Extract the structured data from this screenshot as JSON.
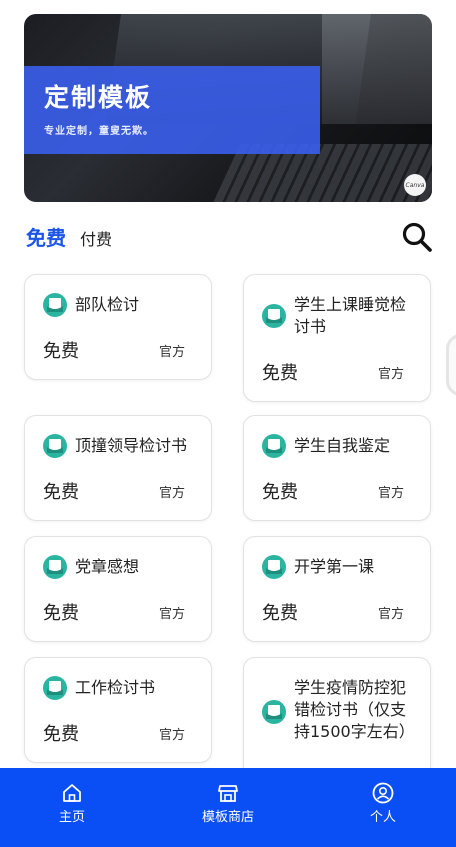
{
  "banner": {
    "title": "定制模板",
    "subtitle": "专业定制，童叟无欺。",
    "badge": "Canva"
  },
  "tabs": {
    "free": "免费",
    "paid": "付费"
  },
  "cards": [
    {
      "name": "部队检讨",
      "price": "免费",
      "tag": "官方"
    },
    {
      "name": "学生上课睡觉检讨书",
      "price": "免费",
      "tag": "官方"
    },
    {
      "name": "顶撞领导检讨书",
      "price": "免费",
      "tag": "官方"
    },
    {
      "name": "学生自我鉴定",
      "price": "免费",
      "tag": "官方"
    },
    {
      "name": "党章感想",
      "price": "免费",
      "tag": "官方"
    },
    {
      "name": "开学第一课",
      "price": "免费",
      "tag": "官方"
    },
    {
      "name": "工作检讨书",
      "price": "免费",
      "tag": "官方"
    },
    {
      "name": "学生疫情防控犯错检讨书（仅支持1500字左右）",
      "price": "",
      "tag": ""
    }
  ],
  "nav": {
    "home": "主页",
    "store": "模板商店",
    "profile": "个人"
  },
  "colors": {
    "accent": "#1a55e8",
    "nav_bg": "#0a4ff5",
    "icon_teal": "#2bb5a0"
  }
}
